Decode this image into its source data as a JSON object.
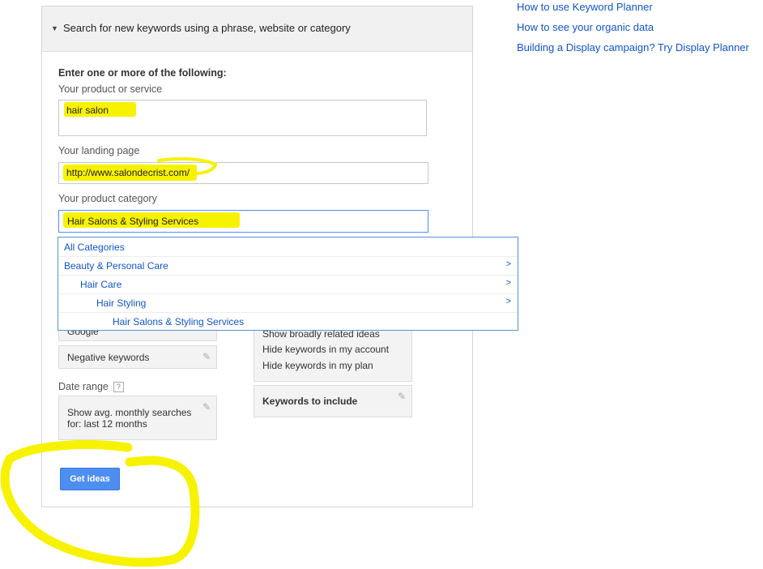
{
  "panel": {
    "title": "Search for new keywords using a phrase, website or category"
  },
  "form": {
    "intro": "Enter one or more of the following:",
    "product_label": "Your product or service",
    "product_value": "hair salon",
    "landing_label": "Your landing page",
    "landing_value": "http://www.salondecrist.com/",
    "category_label": "Your product category",
    "category_value": "Hair Salons & Styling Services"
  },
  "category_dropdown": {
    "items": [
      {
        "label": "All Categories",
        "has_children": false
      },
      {
        "label": "Beauty & Personal Care",
        "has_children": true
      },
      {
        "label": "Hair Care",
        "has_children": true
      },
      {
        "label": "Hair Styling",
        "has_children": true
      },
      {
        "label": "Hair Salons & Styling Services",
        "has_children": false
      }
    ],
    "chevron": ">"
  },
  "targeting": {
    "partial_label": "Google",
    "negative_keywords": "Negative keywords"
  },
  "date_range": {
    "label": "Date range",
    "help": "?",
    "text": "Show avg. monthly searches for: last 12 months"
  },
  "keyword_options": {
    "partial_line": "Show broadly related ideas",
    "line2": "Hide keywords in my account",
    "line3": "Hide keywords in my plan"
  },
  "keywords_to_include": "Keywords to include",
  "get_ideas_button": "Get ideas",
  "right_links": [
    "How to use Keyword Planner",
    "How to see your organic data",
    "Building a Display campaign? Try Display Planner"
  ],
  "colors": {
    "link": "#1155cc",
    "highlight": "#f7f200",
    "button": "#4d8ef0",
    "focus_border": "#4d90fe"
  }
}
